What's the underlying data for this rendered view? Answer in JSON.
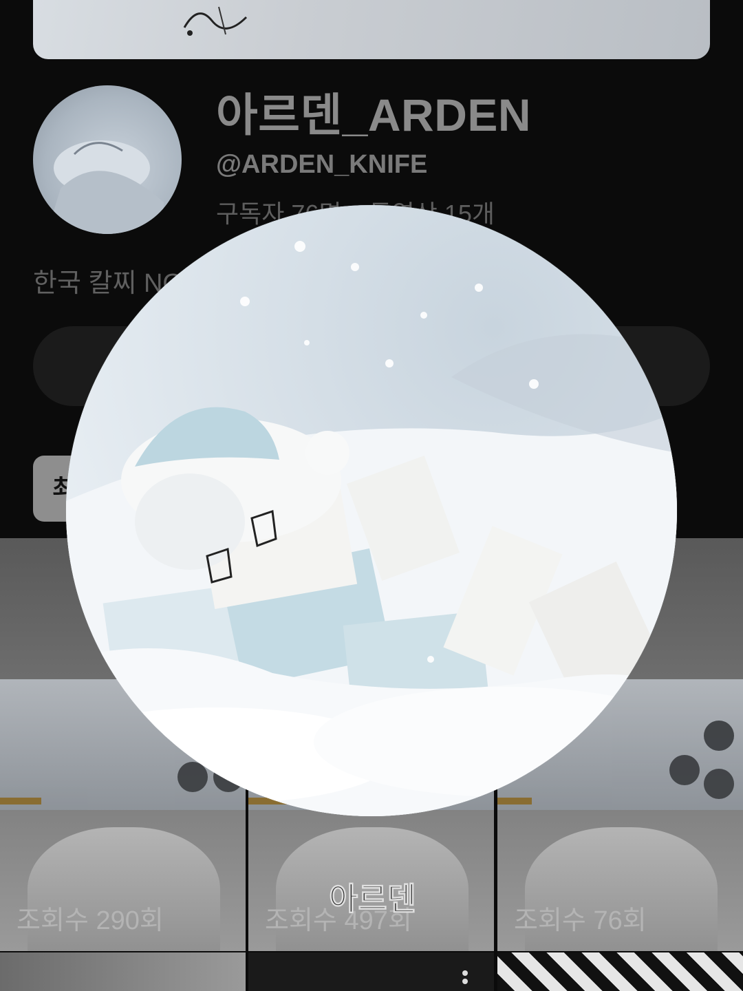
{
  "channel": {
    "name": "아르덴_ARDEN",
    "handle": "@ARDEN_KNIFE",
    "subscribers": "구독자 76명",
    "videos": "동영상 15개",
    "description": "한국 칼찌 NO"
  },
  "filter_chip": {
    "label": "최"
  },
  "videos": [
    {
      "views": "조회수 290회"
    },
    {
      "views": "조회수 497회"
    },
    {
      "views": "조회수 76회"
    }
  ],
  "thumbnail_caption": "아르덴",
  "icons": {
    "more": "vertical-dots-icon"
  },
  "colors": {
    "background": "#0b0b0b",
    "name_text": "#8a8a8a",
    "pic_snow": "#eef3f7",
    "pic_hat": "#bcd6e0"
  }
}
